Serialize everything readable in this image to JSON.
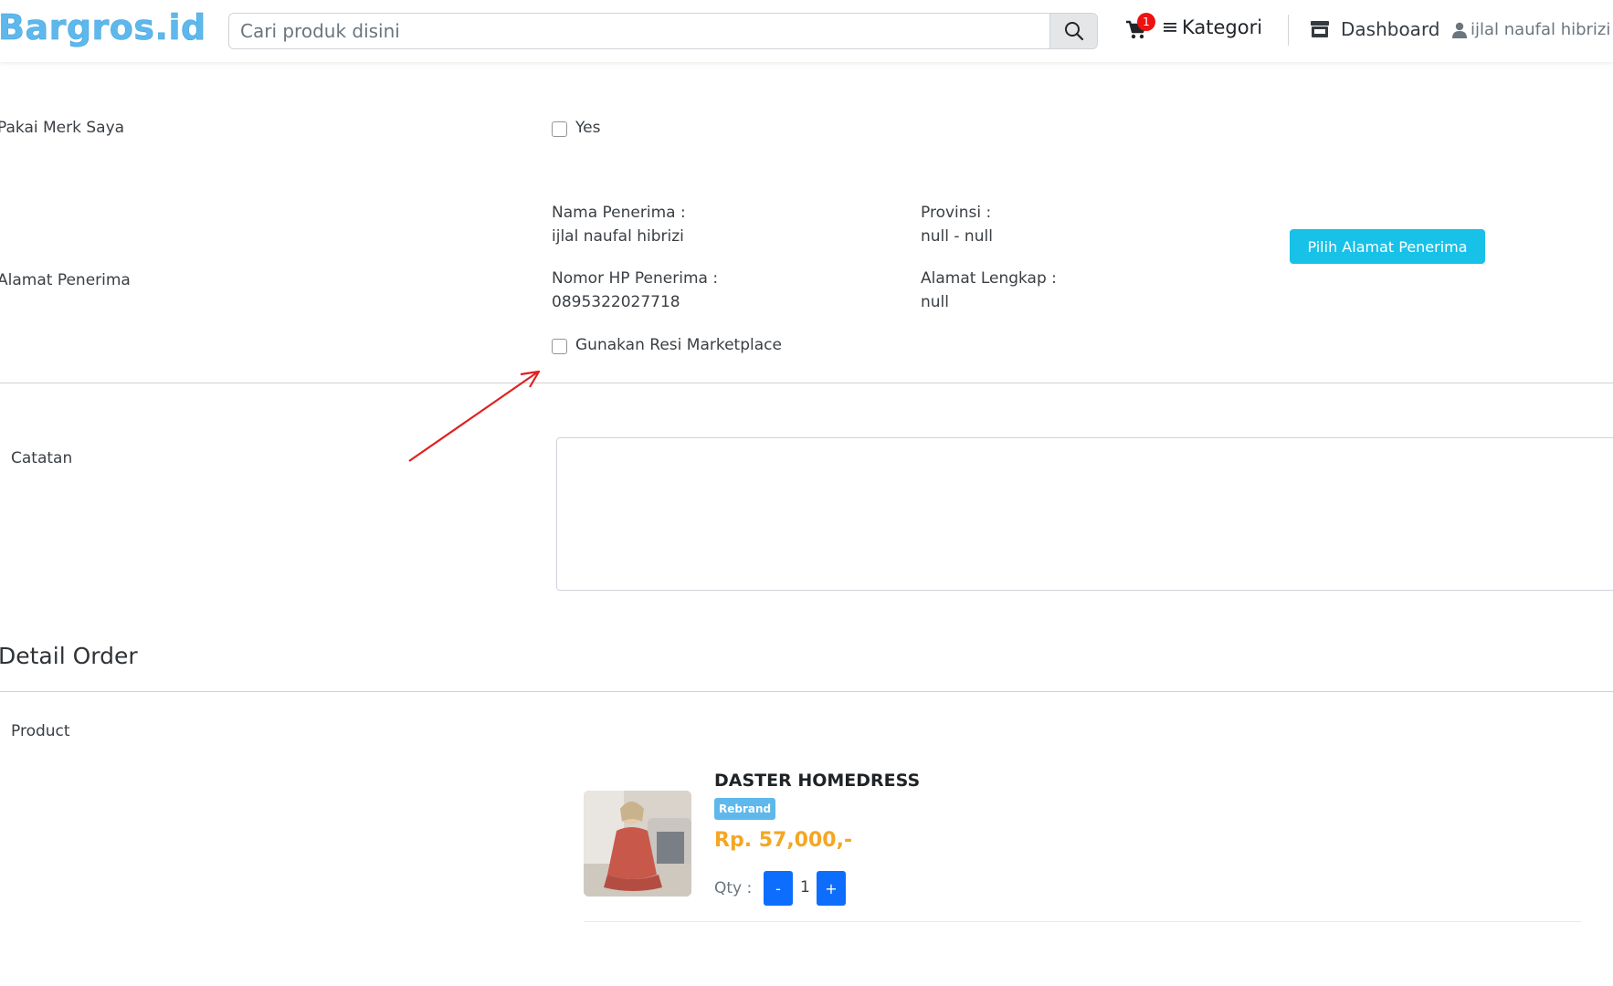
{
  "header": {
    "logo_text": "Bargros.id",
    "search_placeholder": "Cari produk disini",
    "cart_count": "1",
    "kategori_label": "Kategori",
    "dashboard_label": "Dashboard",
    "user_name": "ijlal naufal hibrizi"
  },
  "form": {
    "pakai_merk": {
      "label": "Pakai Merk Saya",
      "checkbox_label": "Yes"
    },
    "alamat": {
      "label": "Alamat Penerima",
      "nama_key": "Nama Penerima :",
      "nama_value": "ijlal naufal hibrizi",
      "hp_key": "Nomor HP Penerima :",
      "hp_value": "0895322027718",
      "provinsi_key": "Provinsi :",
      "provinsi_value": "null - null",
      "lengkap_key": "Alamat Lengkap :",
      "lengkap_value": "null",
      "button_label": "Pilih Alamat Penerima",
      "resi_label": "Gunakan Resi Marketplace"
    },
    "catatan": {
      "label": "Catatan",
      "value": ""
    }
  },
  "detail_order": {
    "title": "Detail Order",
    "product_label": "Product",
    "product": {
      "name": "DASTER HOMEDRESS",
      "badge": "Rebrand",
      "price": "Rp. 57,000,-",
      "qty_label": "Qty :",
      "qty_minus": "-",
      "qty_value": "1",
      "qty_plus": "+"
    }
  },
  "colors": {
    "brand": "#5fb8ec",
    "info_button": "#17c1e8",
    "primary_button": "#0d6efd",
    "price": "#f5a623",
    "badge_red": "#ee1111",
    "annotation_arrow": "#e02020"
  }
}
